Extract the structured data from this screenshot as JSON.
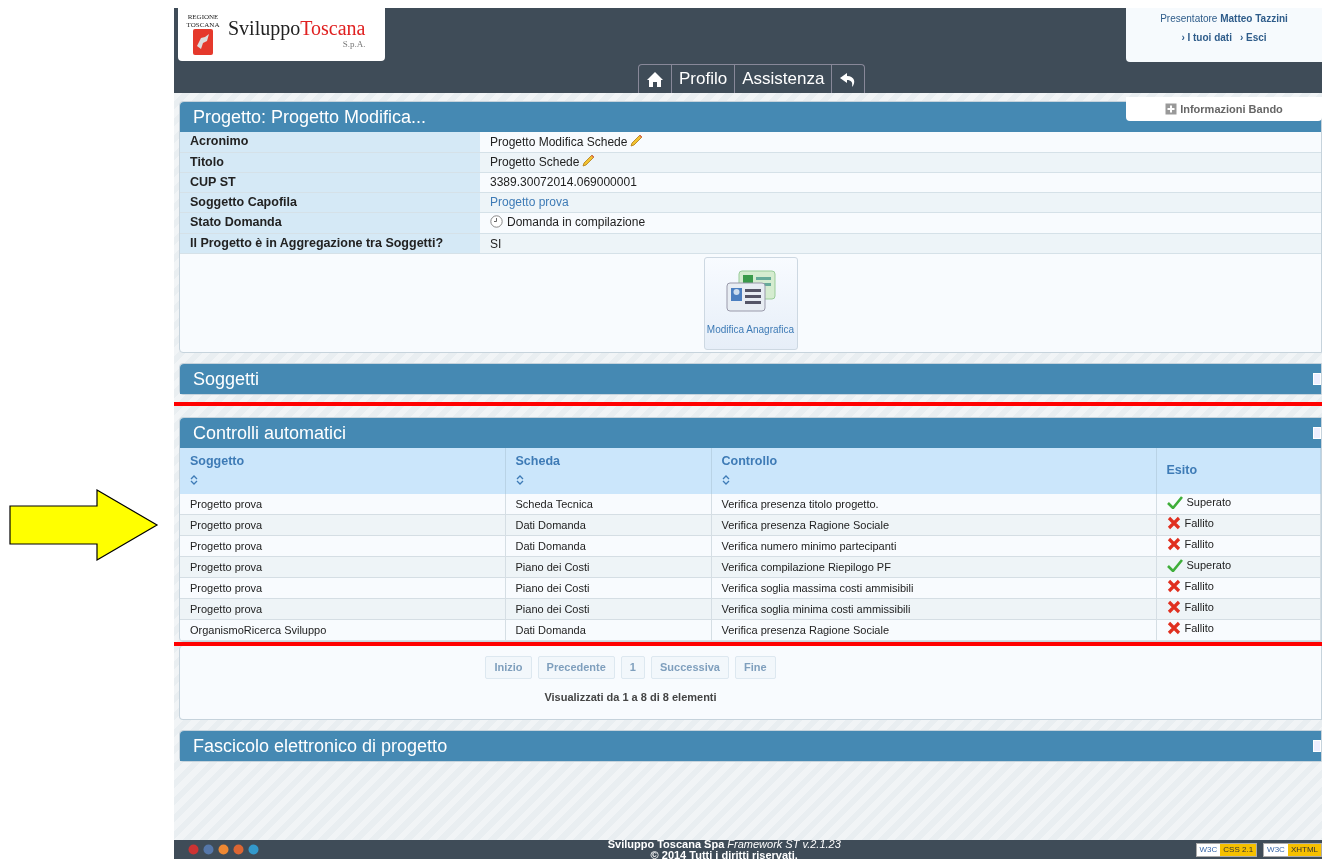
{
  "logo": {
    "region": "REGIONE TOSCANA",
    "brand_first": "Sviluppo",
    "brand_second": "Toscana",
    "suffix": "S.p.A."
  },
  "user_box": {
    "label": "Presentatore",
    "name": "Matteo Tazzini",
    "links": [
      "› I tuoi dati",
      "› Esci"
    ]
  },
  "nav": [
    {
      "kind": "home"
    },
    {
      "kind": "text",
      "label": "Profilo"
    },
    {
      "kind": "text",
      "label": "Assistenza"
    },
    {
      "kind": "back"
    }
  ],
  "info_button": "Informazioni Bando",
  "project_panel": {
    "title": "Progetto: Progetto Modifica...",
    "fields": [
      {
        "label": "Acronimo",
        "value": "Progetto Modifica Schede",
        "kind": "editable"
      },
      {
        "label": "Titolo",
        "value": "Progetto Schede",
        "kind": "editable"
      },
      {
        "label": "CUP ST",
        "value": "3389.30072014.069000001",
        "kind": "text"
      },
      {
        "label": "Soggetto Capofila",
        "value": "Progetto prova",
        "kind": "link"
      },
      {
        "label": "Stato Domanda",
        "value": "Domanda in compilazione",
        "kind": "status"
      },
      {
        "label": "Il Progetto è in Aggregazione tra Soggetti?",
        "value": "SI",
        "kind": "text"
      }
    ],
    "actions": [
      {
        "label": "Modifica Anagrafica"
      }
    ]
  },
  "soggetti_panel": {
    "title": "Soggetti"
  },
  "controlli_panel": {
    "title": "Controlli automatici",
    "columns": [
      {
        "label": "Soggetto",
        "sortable": true
      },
      {
        "label": "Scheda",
        "sortable": true
      },
      {
        "label": "Controllo",
        "sortable": true
      },
      {
        "label": "Esito",
        "sortable": false
      }
    ],
    "rows": [
      {
        "soggetto": "Progetto prova",
        "scheda": "Scheda Tecnica",
        "controllo": "Verifica presenza titolo progetto.",
        "esito": "Superato",
        "passed": true
      },
      {
        "soggetto": "Progetto prova",
        "scheda": "Dati Domanda",
        "controllo": "Verifica presenza Ragione Sociale",
        "esito": "Fallito",
        "passed": false
      },
      {
        "soggetto": "Progetto prova",
        "scheda": "Dati Domanda",
        "controllo": "Verifica numero minimo partecipanti",
        "esito": "Fallito",
        "passed": false
      },
      {
        "soggetto": "Progetto prova",
        "scheda": "Piano dei Costi",
        "controllo": "Verifica compilazione Riepilogo PF",
        "esito": "Superato",
        "passed": true
      },
      {
        "soggetto": "Progetto prova",
        "scheda": "Piano dei Costi",
        "controllo": "Verifica soglia massima costi ammisibili",
        "esito": "Fallito",
        "passed": false
      },
      {
        "soggetto": "Progetto prova",
        "scheda": "Piano dei Costi",
        "controllo": "Verifica soglia minima costi ammissibili",
        "esito": "Fallito",
        "passed": false
      },
      {
        "soggetto": "OrganismoRicerca Sviluppo",
        "scheda": "Dati Domanda",
        "controllo": "Verifica presenza Ragione Sociale",
        "esito": "Fallito",
        "passed": false
      }
    ],
    "pagination": [
      {
        "label": "Inizio",
        "disabled": true
      },
      {
        "label": "Precedente",
        "disabled": true
      },
      {
        "label": "1",
        "disabled": true
      },
      {
        "label": "Successiva",
        "disabled": true
      },
      {
        "label": "Fine",
        "disabled": true
      }
    ],
    "info": "Visualizzati da 1 a 8 di 8 elementi"
  },
  "fascicolo_panel": {
    "title": "Fascicolo elettronico di progetto"
  },
  "footer": {
    "company": "Sviluppo Toscana Spa",
    "framework": "Framework ST v.2.1.23",
    "copyright": "© 2014 Tutti i diritti riservati.",
    "badges": [
      {
        "left": "W3C",
        "right": "CSS 2.1"
      },
      {
        "left": "W3C",
        "right": "XHTML"
      }
    ]
  }
}
